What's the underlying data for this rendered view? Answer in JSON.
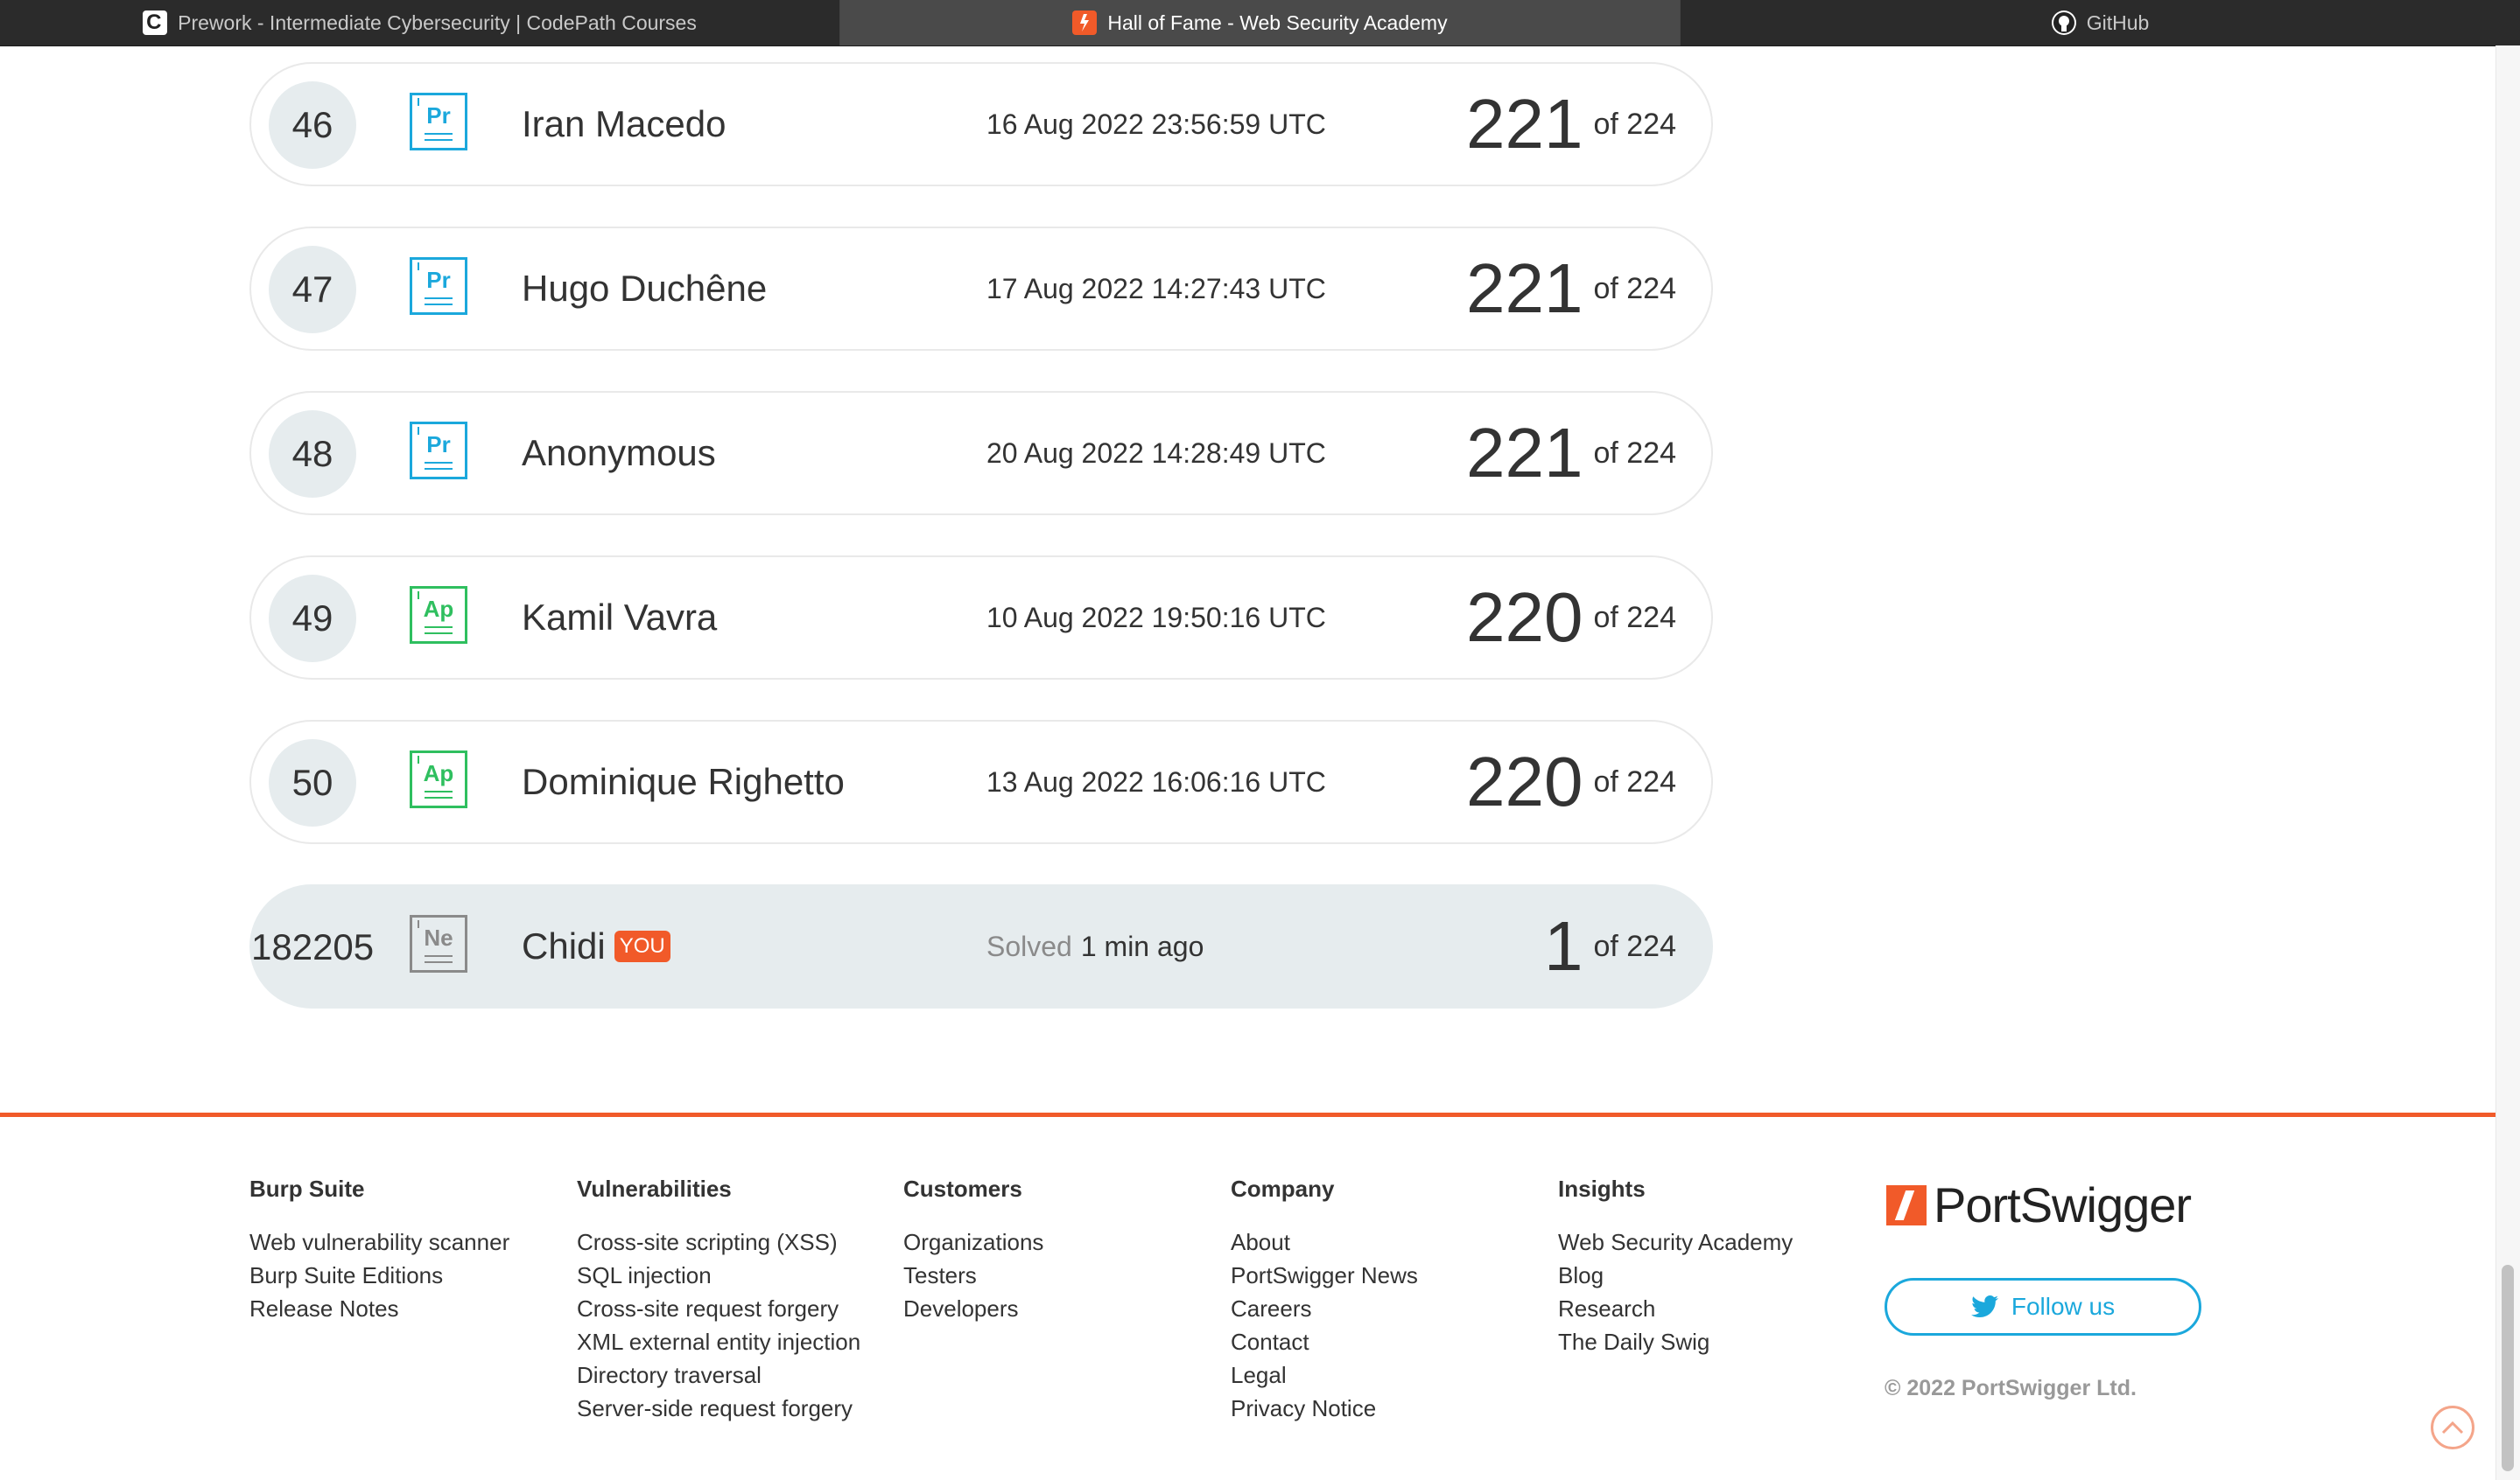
{
  "tabs": [
    {
      "label": "Prework - Intermediate Cybersecurity | CodePath Courses",
      "icon": "codepath-icon",
      "active": false
    },
    {
      "label": "Hall of Fame - Web Security Academy",
      "icon": "portswigger-icon",
      "active": true
    },
    {
      "label": "GitHub",
      "icon": "github-icon",
      "active": false
    }
  ],
  "leaderboard": {
    "rows": [
      {
        "rank": "46",
        "badge": "Pr",
        "badge_color": "#1ba8dc",
        "name": "Iran Macedo",
        "date": "16 Aug 2022 23:56:59 UTC",
        "score": "221",
        "of": "of 224"
      },
      {
        "rank": "47",
        "badge": "Pr",
        "badge_color": "#1ba8dc",
        "name": "Hugo Duchêne",
        "date": "17 Aug 2022 14:27:43 UTC",
        "score": "221",
        "of": "of 224"
      },
      {
        "rank": "48",
        "badge": "Pr",
        "badge_color": "#1ba8dc",
        "name": "Anonymous",
        "date": "20 Aug 2022 14:28:49 UTC",
        "score": "221",
        "of": "of 224"
      },
      {
        "rank": "49",
        "badge": "Ap",
        "badge_color": "#2fbf5f",
        "name": "Kamil Vavra",
        "date": "10 Aug 2022 19:50:16 UTC",
        "score": "220",
        "of": "of 224"
      },
      {
        "rank": "50",
        "badge": "Ap",
        "badge_color": "#2fbf5f",
        "name": "Dominique Righetto",
        "date": "13 Aug 2022 16:06:16 UTC",
        "score": "220",
        "of": "of 224"
      }
    ],
    "you": {
      "rank": "182205",
      "badge": "Ne",
      "badge_color": "#8a8a8a",
      "name": "Chidi",
      "tag": "YOU",
      "solved_label": "Solved",
      "solved_time": "1 min ago",
      "score": "1",
      "of": "of 224"
    }
  },
  "footer": {
    "columns": [
      {
        "heading": "Burp Suite",
        "links": [
          "Web vulnerability scanner",
          "Burp Suite Editions",
          "Release Notes"
        ]
      },
      {
        "heading": "Vulnerabilities",
        "links": [
          "Cross-site scripting (XSS)",
          "SQL injection",
          "Cross-site request forgery",
          "XML external entity injection",
          "Directory traversal",
          "Server-side request forgery"
        ]
      },
      {
        "heading": "Customers",
        "links": [
          "Organizations",
          "Testers",
          "Developers"
        ]
      },
      {
        "heading": "Company",
        "links": [
          "About",
          "PortSwigger News",
          "Careers",
          "Contact",
          "Legal",
          "Privacy Notice"
        ]
      },
      {
        "heading": "Insights",
        "links": [
          "Web Security Academy",
          "Blog",
          "Research",
          "The Daily Swig"
        ]
      }
    ],
    "brand": "PortSwigger",
    "follow_label": "Follow us",
    "copyright": "© 2022 PortSwigger Ltd.",
    "accent_color": "#f15a29",
    "twitter_color": "#1ba8dc"
  }
}
